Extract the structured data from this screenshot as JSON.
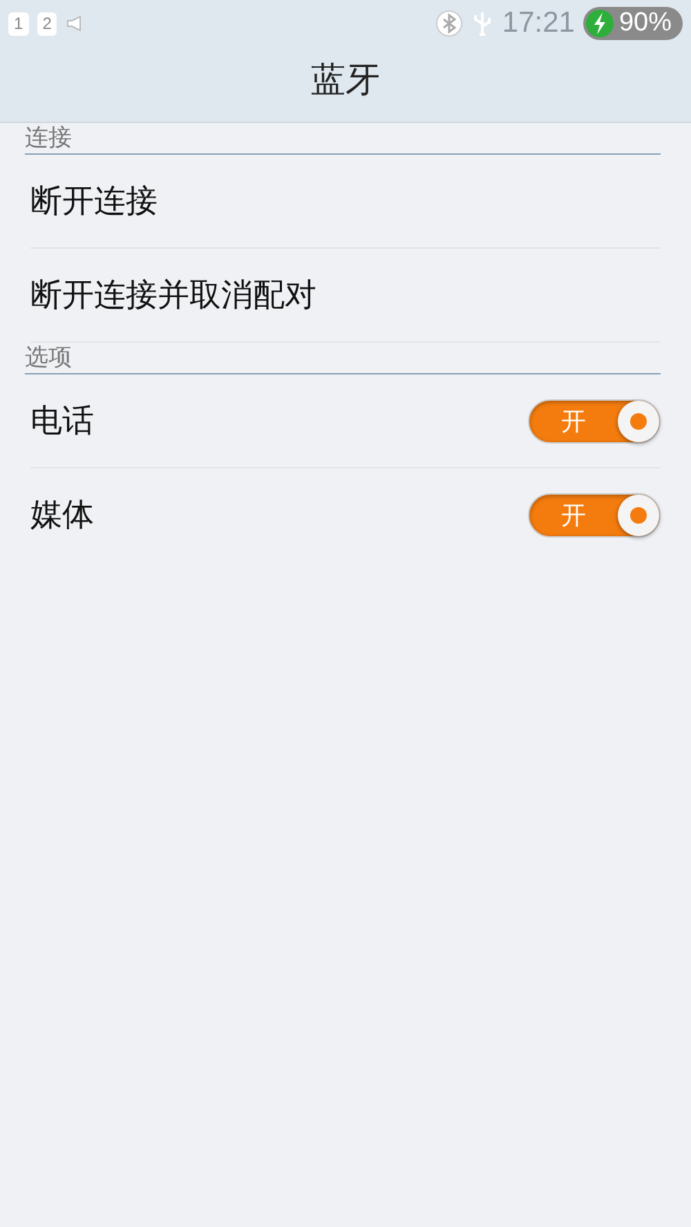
{
  "status_bar": {
    "sim_slots": [
      "1",
      "2"
    ],
    "time": "17:21",
    "battery": "90%"
  },
  "title": "蓝牙",
  "sections": [
    {
      "header": "连接",
      "items": [
        {
          "kind": "action",
          "label": "断开连接"
        },
        {
          "kind": "action",
          "label": "断开连接并取消配对"
        }
      ]
    },
    {
      "header": "选项",
      "items": [
        {
          "kind": "toggle",
          "label": "电话",
          "on": true,
          "switch_text": "开"
        },
        {
          "kind": "toggle",
          "label": "媒体",
          "on": true,
          "switch_text": "开"
        }
      ]
    }
  ]
}
